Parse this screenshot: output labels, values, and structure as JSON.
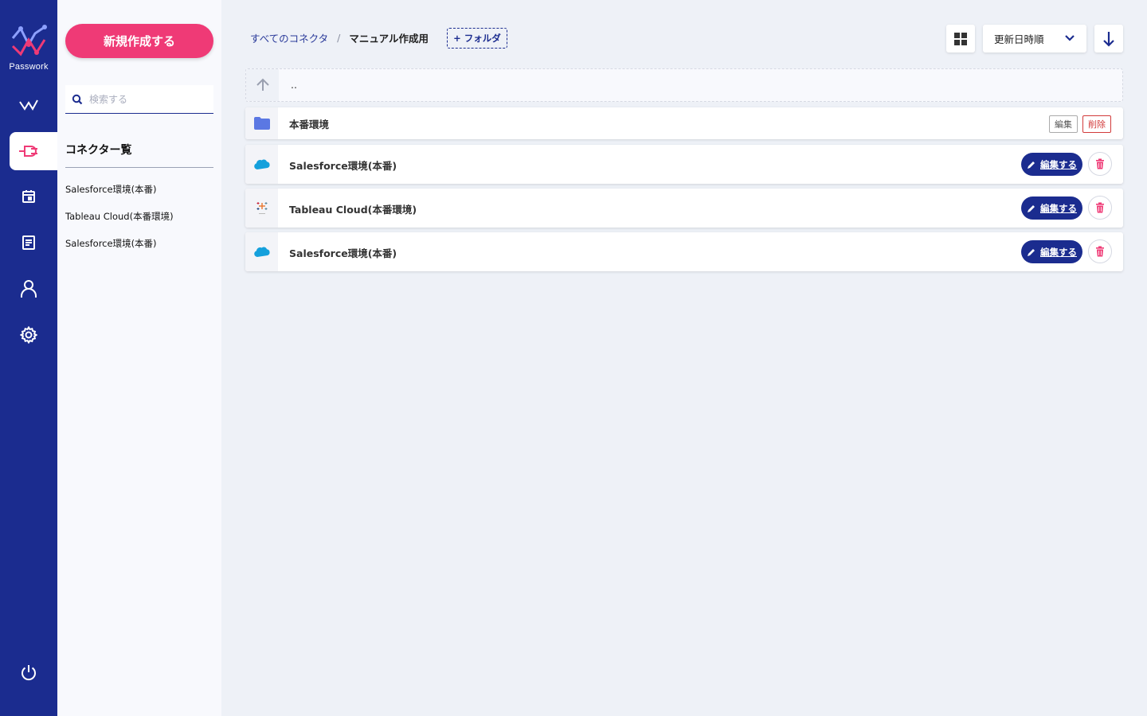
{
  "brand": {
    "name": "Passwork"
  },
  "colors": {
    "primary": "#1b2c8f",
    "accent": "#ef3a76"
  },
  "nav": {
    "items": [
      {
        "icon": "checkmark-icon"
      },
      {
        "icon": "plug-icon",
        "active": true
      },
      {
        "icon": "calendar-icon"
      },
      {
        "icon": "document-icon"
      },
      {
        "icon": "user-icon"
      },
      {
        "icon": "gear-icon"
      },
      {
        "icon": "power-icon"
      }
    ]
  },
  "sidebar": {
    "new_button": "新規作成する",
    "search_placeholder": "検索する",
    "title": "コネクター覧",
    "items": [
      {
        "label": "Salesforce環境(本番)"
      },
      {
        "label": "Tableau Cloud(本番環境)"
      },
      {
        "label": "Salesforce環境(本番)"
      }
    ]
  },
  "header": {
    "breadcrumb_root": "すべてのコネクタ",
    "breadcrumb_separator": "/",
    "breadcrumb_current": "マニュアル作成用",
    "add_folder_label": "+ フォルダ",
    "sort_label": "更新日時順"
  },
  "list": {
    "parent_label": "..",
    "folder": {
      "label": "本番環境",
      "edit_label": "編集",
      "delete_label": "削除"
    },
    "connectors": [
      {
        "label": "Salesforce環境(本番)",
        "edit_label": "編集する",
        "icon": "salesforce-icon"
      },
      {
        "label": "Tableau Cloud(本番環境)",
        "edit_label": "編集する",
        "icon": "tableau-icon"
      },
      {
        "label": "Salesforce環境(本番)",
        "edit_label": "編集する",
        "icon": "salesforce-icon"
      }
    ]
  }
}
